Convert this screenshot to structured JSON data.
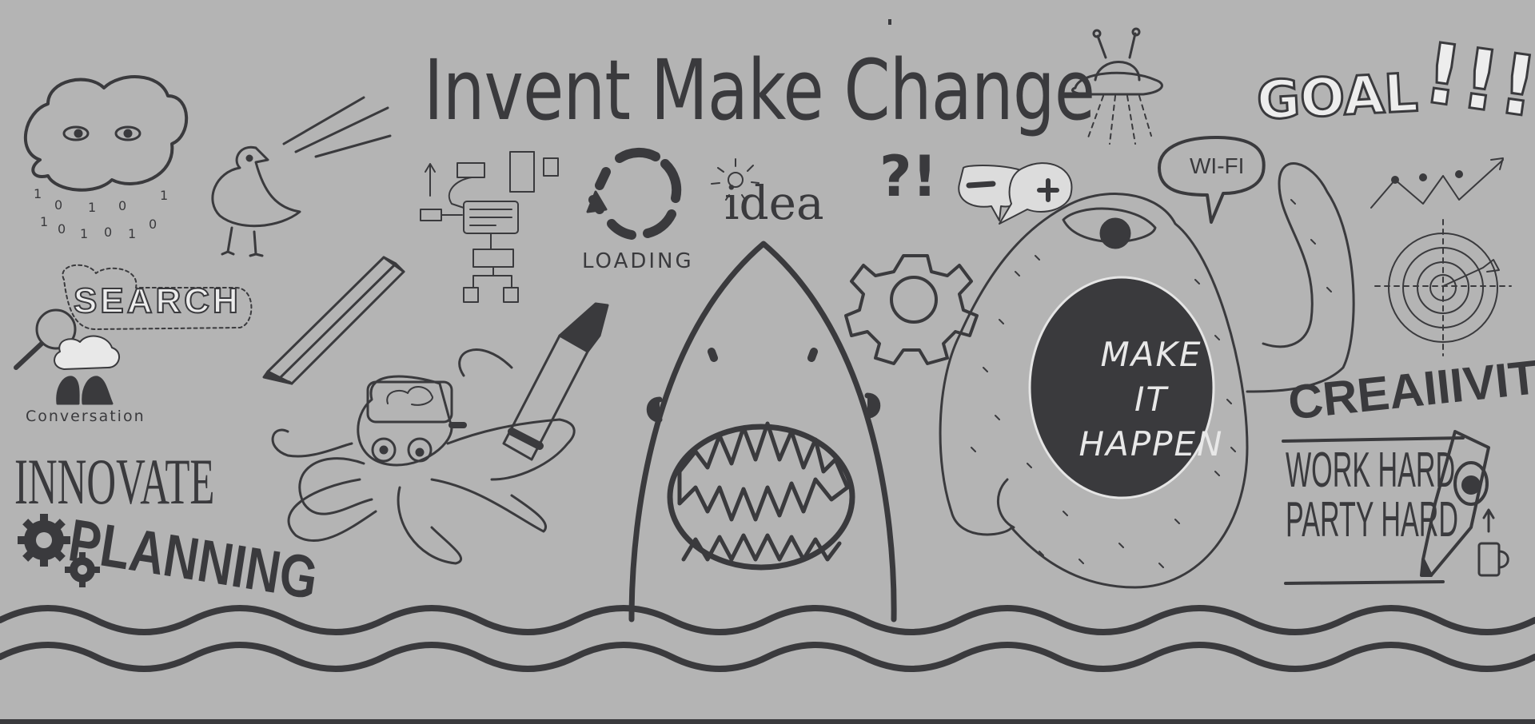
{
  "colors": {
    "background": "#b4b4b4",
    "ink": "#3a3a3d",
    "light": "#e8e8e8"
  },
  "texts": {
    "title": "Invent Make Change",
    "loading": "LOADING",
    "idea": "idea",
    "question_exclaim": "?!",
    "wifi": "WI-FI",
    "goal": "GOAL",
    "goal_bang": "!!!",
    "search": "SEARCH",
    "conversation": "Conversation",
    "innovate": "INNOVATE",
    "planning": "PLANNING",
    "make_it_happen": [
      "MAKE",
      "IT",
      "HAPPEN"
    ],
    "creativity": "CREAIIIVITY",
    "work_hard": "WORK HARD",
    "party_hard": "PARTY HARD"
  },
  "icons": [
    "cloud-icon",
    "bird-icon",
    "flowchart-icon",
    "loading-icon",
    "lightbulb-icon",
    "speech-bubble-icon",
    "ufo-icon",
    "chart-arrow-icon",
    "target-icon",
    "magnifier-icon",
    "pencil-icon",
    "octopus-icon",
    "marker-icon",
    "shark-icon",
    "gear-icon",
    "monster-icon",
    "beer-icon"
  ]
}
